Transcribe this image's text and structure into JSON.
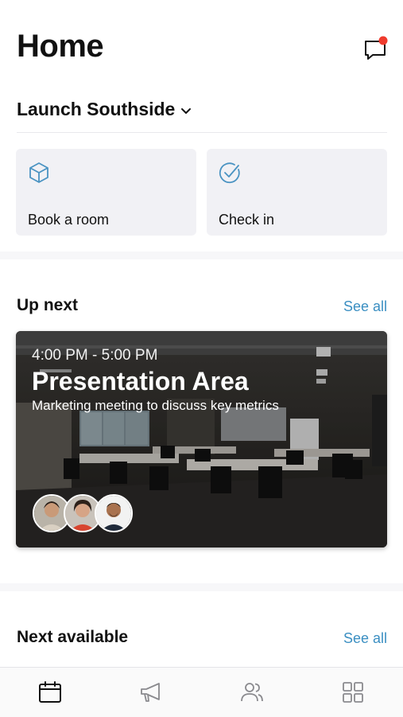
{
  "header": {
    "title": "Home",
    "chat_icon": "chat-bubble-icon",
    "notification_color": "#ef3b2d"
  },
  "location": {
    "name": "Launch Southside",
    "icon": "chevron-down-icon"
  },
  "quick_actions": [
    {
      "label": "Book a room",
      "icon": "cube-icon"
    },
    {
      "label": "Check in",
      "icon": "check-circle-icon"
    }
  ],
  "up_next": {
    "title": "Up next",
    "see_all": "See all",
    "event": {
      "time": "4:00 PM - 5:00 PM",
      "room": "Presentation Area",
      "description": "Marketing meeting to discuss key metrics",
      "attendee_count": 3
    }
  },
  "next_available": {
    "title": "Next available",
    "see_all": "See all"
  },
  "tabbar": {
    "tabs": [
      {
        "icon": "calendar-icon",
        "active": true
      },
      {
        "icon": "megaphone-icon",
        "active": false
      },
      {
        "icon": "people-icon",
        "active": false
      },
      {
        "icon": "grid-icon",
        "active": false
      }
    ]
  },
  "colors": {
    "accent": "#3b8fc2",
    "card_bg": "#f1f1f5",
    "icon_blue": "#4a93c2"
  }
}
